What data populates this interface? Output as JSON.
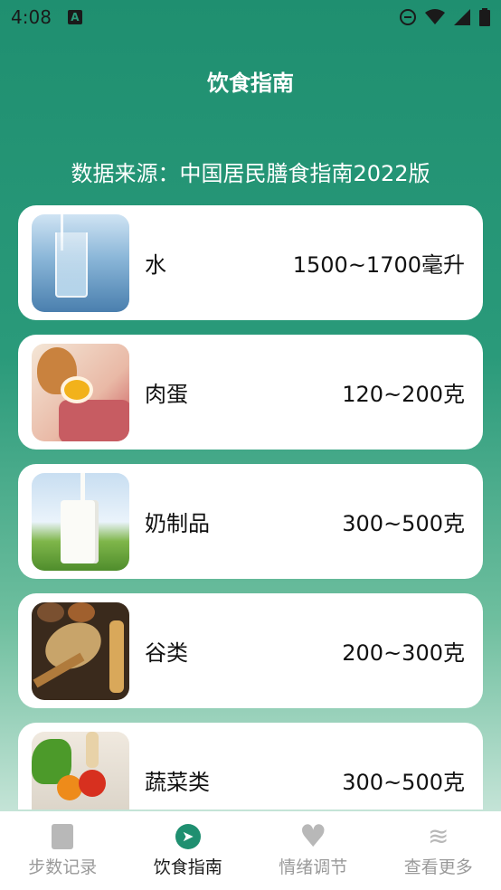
{
  "status_bar": {
    "time": "4:08",
    "app_badge": "A"
  },
  "header": {
    "title": "饮食指南"
  },
  "source_text": "数据来源：中国居民膳食指南2022版",
  "items": [
    {
      "name": "水",
      "amount": "1500~1700毫升",
      "icon": "water-glass-image"
    },
    {
      "name": "肉蛋",
      "amount": "120~200克",
      "icon": "meat-egg-image"
    },
    {
      "name": "奶制品",
      "amount": "300~500克",
      "icon": "milk-image"
    },
    {
      "name": "谷类",
      "amount": "200~300克",
      "icon": "grain-image"
    },
    {
      "name": "蔬菜类",
      "amount": "300~500克",
      "icon": "vegetables-image"
    }
  ],
  "tabs": [
    {
      "label": "步数记录",
      "icon": "notebook-icon",
      "active": false
    },
    {
      "label": "饮食指南",
      "icon": "compass-icon",
      "active": true
    },
    {
      "label": "情绪调节",
      "icon": "heart-icon",
      "active": false
    },
    {
      "label": "查看更多",
      "icon": "layers-icon",
      "active": false
    }
  ],
  "colors": {
    "accent": "#1f8f70",
    "inactive_tab": "#9a9a9a"
  }
}
